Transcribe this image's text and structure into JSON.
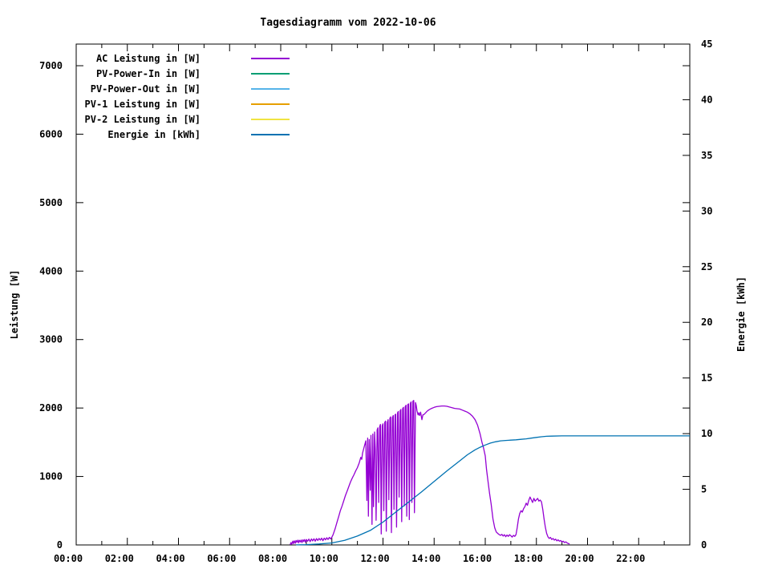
{
  "chart_data": {
    "type": "line",
    "title": "Tagesdiagramm vom 2022-10-06",
    "grid": false,
    "legend_position": "top-left-inside",
    "x_axis": {
      "unit": "time-of-day",
      "range_hours": [
        0,
        24
      ],
      "major_tick_hours": [
        0,
        2,
        4,
        6,
        8,
        10,
        12,
        14,
        16,
        18,
        20,
        22
      ],
      "minor_tick_hours": [
        1,
        3,
        5,
        7,
        9,
        11,
        13,
        15,
        17,
        19,
        21,
        23
      ],
      "tick_labels": [
        "00:00",
        "02:00",
        "04:00",
        "06:00",
        "08:00",
        "10:00",
        "12:00",
        "14:00",
        "16:00",
        "18:00",
        "20:00",
        "22:00"
      ]
    },
    "y_left": {
      "label": "Leistung [W]",
      "range": [
        0,
        7320
      ],
      "ticks": [
        0,
        1000,
        2000,
        3000,
        4000,
        5000,
        6000,
        7000
      ]
    },
    "y_right": {
      "label": "Energie [kWh]",
      "range": [
        0,
        45
      ],
      "ticks": [
        0,
        5,
        10,
        15,
        20,
        25,
        30,
        35,
        40,
        45
      ]
    },
    "legend": [
      {
        "label": "AC Leistung in [W]",
        "color": "#9400d3"
      },
      {
        "label": "PV-Power-In in [W]",
        "color": "#009e73"
      },
      {
        "label": "PV-Power-Out in [W]",
        "color": "#56b4e9"
      },
      {
        "label": "PV-1 Leistung in [W]",
        "color": "#e69f00"
      },
      {
        "label": "PV-2 Leistung in [W]",
        "color": "#f0e442"
      },
      {
        "label": "Energie in [kWh]",
        "color": "#0072b2"
      }
    ],
    "series": [
      {
        "name": "AC Leistung in [W]",
        "axis": "left",
        "color": "#9400d3",
        "points": [
          [
            8.37,
            5
          ],
          [
            8.4,
            35
          ],
          [
            8.43,
            10
          ],
          [
            8.47,
            55
          ],
          [
            8.5,
            20
          ],
          [
            8.53,
            60
          ],
          [
            8.57,
            25
          ],
          [
            8.6,
            65
          ],
          [
            8.63,
            40
          ],
          [
            8.67,
            70
          ],
          [
            8.7,
            30
          ],
          [
            8.73,
            68
          ],
          [
            8.77,
            45
          ],
          [
            8.8,
            72
          ],
          [
            8.83,
            35
          ],
          [
            8.87,
            75
          ],
          [
            8.9,
            50
          ],
          [
            8.93,
            78
          ],
          [
            8.97,
            40
          ],
          [
            9.0,
            80
          ],
          [
            9.05,
            55
          ],
          [
            9.1,
            85
          ],
          [
            9.15,
            48
          ],
          [
            9.2,
            88
          ],
          [
            9.25,
            60
          ],
          [
            9.3,
            90
          ],
          [
            9.35,
            55
          ],
          [
            9.4,
            92
          ],
          [
            9.45,
            65
          ],
          [
            9.5,
            95
          ],
          [
            9.55,
            70
          ],
          [
            9.6,
            98
          ],
          [
            9.65,
            62
          ],
          [
            9.7,
            100
          ],
          [
            9.75,
            75
          ],
          [
            9.8,
            105
          ],
          [
            9.85,
            80
          ],
          [
            9.9,
            110
          ],
          [
            9.95,
            88
          ],
          [
            10.0,
            115
          ],
          [
            10.05,
            150
          ],
          [
            10.13,
            240
          ],
          [
            10.2,
            330
          ],
          [
            10.27,
            420
          ],
          [
            10.33,
            500
          ],
          [
            10.4,
            570
          ],
          [
            10.47,
            650
          ],
          [
            10.53,
            720
          ],
          [
            10.6,
            790
          ],
          [
            10.67,
            860
          ],
          [
            10.73,
            920
          ],
          [
            10.8,
            980
          ],
          [
            10.87,
            1030
          ],
          [
            10.93,
            1080
          ],
          [
            11.0,
            1130
          ],
          [
            11.07,
            1200
          ],
          [
            11.13,
            1280
          ],
          [
            11.17,
            1250
          ],
          [
            11.2,
            1340
          ],
          [
            11.27,
            1440
          ],
          [
            11.33,
            1520
          ],
          [
            11.37,
            650
          ],
          [
            11.4,
            1560
          ],
          [
            11.43,
            420
          ],
          [
            11.46,
            1540
          ],
          [
            11.5,
            800
          ],
          [
            11.53,
            1600
          ],
          [
            11.57,
            300
          ],
          [
            11.6,
            1620
          ],
          [
            11.63,
            560
          ],
          [
            11.67,
            1650
          ],
          [
            11.7,
            1400
          ],
          [
            11.73,
            360
          ],
          [
            11.77,
            1680
          ],
          [
            11.8,
            1710
          ],
          [
            11.83,
            620
          ],
          [
            11.87,
            1730
          ],
          [
            11.9,
            1760
          ],
          [
            11.93,
            160
          ],
          [
            11.97,
            1740
          ],
          [
            12.0,
            1770
          ],
          [
            12.03,
            500
          ],
          [
            12.07,
            1790
          ],
          [
            12.1,
            1810
          ],
          [
            12.13,
            200
          ],
          [
            12.17,
            1790
          ],
          [
            12.2,
            1830
          ],
          [
            12.23,
            660
          ],
          [
            12.27,
            1850
          ],
          [
            12.3,
            1870
          ],
          [
            12.33,
            180
          ],
          [
            12.37,
            1860
          ],
          [
            12.4,
            1890
          ],
          [
            12.43,
            520
          ],
          [
            12.47,
            1900
          ],
          [
            12.5,
            1910
          ],
          [
            12.53,
            260
          ],
          [
            12.57,
            1930
          ],
          [
            12.6,
            1950
          ],
          [
            12.63,
            700
          ],
          [
            12.67,
            1960
          ],
          [
            12.7,
            1980
          ],
          [
            12.73,
            340
          ],
          [
            12.77,
            1990
          ],
          [
            12.8,
            2010
          ],
          [
            12.83,
            570
          ],
          [
            12.87,
            2020
          ],
          [
            12.9,
            2040
          ],
          [
            12.93,
            420
          ],
          [
            12.97,
            2050
          ],
          [
            13.0,
            2060
          ],
          [
            13.03,
            370
          ],
          [
            13.07,
            2070
          ],
          [
            13.1,
            2090
          ],
          [
            13.13,
            620
          ],
          [
            13.17,
            2100
          ],
          [
            13.2,
            2110
          ],
          [
            13.23,
            470
          ],
          [
            13.27,
            2080
          ],
          [
            13.3,
            2040
          ],
          [
            13.33,
            1960
          ],
          [
            13.37,
            1900
          ],
          [
            13.4,
            1930
          ],
          [
            13.43,
            1890
          ],
          [
            13.47,
            1940
          ],
          [
            13.52,
            1830
          ],
          [
            13.56,
            1900
          ],
          [
            13.6,
            1905
          ],
          [
            13.67,
            1930
          ],
          [
            13.73,
            1955
          ],
          [
            13.8,
            1975
          ],
          [
            13.9,
            1995
          ],
          [
            14.0,
            2010
          ],
          [
            14.1,
            2020
          ],
          [
            14.2,
            2025
          ],
          [
            14.3,
            2030
          ],
          [
            14.4,
            2030
          ],
          [
            14.5,
            2025
          ],
          [
            14.6,
            2015
          ],
          [
            14.7,
            2005
          ],
          [
            14.8,
            1995
          ],
          [
            14.9,
            1990
          ],
          [
            15.0,
            1985
          ],
          [
            15.1,
            1970
          ],
          [
            15.2,
            1955
          ],
          [
            15.3,
            1940
          ],
          [
            15.4,
            1915
          ],
          [
            15.5,
            1880
          ],
          [
            15.6,
            1830
          ],
          [
            15.7,
            1750
          ],
          [
            15.8,
            1620
          ],
          [
            15.87,
            1500
          ],
          [
            15.93,
            1420
          ],
          [
            16.0,
            1300
          ],
          [
            16.05,
            1100
          ],
          [
            16.1,
            950
          ],
          [
            16.17,
            750
          ],
          [
            16.23,
            600
          ],
          [
            16.3,
            380
          ],
          [
            16.37,
            250
          ],
          [
            16.43,
            190
          ],
          [
            16.5,
            165
          ],
          [
            16.55,
            150
          ],
          [
            16.6,
            140
          ],
          [
            16.65,
            155
          ],
          [
            16.7,
            130
          ],
          [
            16.75,
            150
          ],
          [
            16.8,
            120
          ],
          [
            16.85,
            145
          ],
          [
            16.9,
            125
          ],
          [
            16.95,
            150
          ],
          [
            17.0,
            135
          ],
          [
            17.05,
            115
          ],
          [
            17.1,
            140
          ],
          [
            17.15,
            125
          ],
          [
            17.2,
            150
          ],
          [
            17.25,
            250
          ],
          [
            17.3,
            380
          ],
          [
            17.35,
            460
          ],
          [
            17.4,
            500
          ],
          [
            17.45,
            480
          ],
          [
            17.5,
            530
          ],
          [
            17.55,
            560
          ],
          [
            17.6,
            610
          ],
          [
            17.65,
            580
          ],
          [
            17.7,
            650
          ],
          [
            17.75,
            700
          ],
          [
            17.8,
            660
          ],
          [
            17.85,
            620
          ],
          [
            17.9,
            680
          ],
          [
            17.95,
            640
          ],
          [
            18.0,
            660
          ],
          [
            18.05,
            680
          ],
          [
            18.1,
            640
          ],
          [
            18.15,
            655
          ],
          [
            18.2,
            630
          ],
          [
            18.25,
            520
          ],
          [
            18.3,
            380
          ],
          [
            18.35,
            260
          ],
          [
            18.4,
            170
          ],
          [
            18.45,
            120
          ],
          [
            18.5,
            95
          ],
          [
            18.55,
            110
          ],
          [
            18.6,
            80
          ],
          [
            18.65,
            95
          ],
          [
            18.7,
            70
          ],
          [
            18.75,
            85
          ],
          [
            18.8,
            60
          ],
          [
            18.85,
            75
          ],
          [
            18.9,
            55
          ],
          [
            18.95,
            65
          ],
          [
            19.0,
            45
          ],
          [
            19.05,
            55
          ],
          [
            19.1,
            35
          ],
          [
            19.15,
            45
          ],
          [
            19.2,
            30
          ],
          [
            19.25,
            20
          ],
          [
            19.3,
            15
          ]
        ]
      },
      {
        "name": "Energie in [kWh]",
        "axis": "right",
        "color": "#0072b2",
        "points": [
          [
            8.6,
            0.01
          ],
          [
            9.0,
            0.03
          ],
          [
            9.5,
            0.09
          ],
          [
            10.0,
            0.18
          ],
          [
            10.5,
            0.42
          ],
          [
            11.0,
            0.8
          ],
          [
            11.5,
            1.3
          ],
          [
            12.0,
            2.05
          ],
          [
            12.5,
            2.95
          ],
          [
            13.0,
            3.85
          ],
          [
            13.5,
            4.75
          ],
          [
            14.0,
            5.7
          ],
          [
            14.5,
            6.65
          ],
          [
            15.0,
            7.55
          ],
          [
            15.3,
            8.1
          ],
          [
            15.6,
            8.55
          ],
          [
            15.8,
            8.78
          ],
          [
            16.0,
            8.98
          ],
          [
            16.2,
            9.15
          ],
          [
            16.4,
            9.27
          ],
          [
            16.6,
            9.35
          ],
          [
            16.8,
            9.39
          ],
          [
            17.0,
            9.42
          ],
          [
            17.2,
            9.45
          ],
          [
            17.4,
            9.49
          ],
          [
            17.6,
            9.53
          ],
          [
            17.8,
            9.6
          ],
          [
            18.0,
            9.66
          ],
          [
            18.2,
            9.72
          ],
          [
            18.4,
            9.76
          ],
          [
            18.6,
            9.78
          ],
          [
            19.0,
            9.8
          ],
          [
            19.5,
            9.8
          ],
          [
            20.0,
            9.8
          ],
          [
            21.0,
            9.8
          ],
          [
            22.0,
            9.8
          ],
          [
            23.0,
            9.8
          ],
          [
            24.0,
            9.8
          ]
        ]
      }
    ]
  }
}
